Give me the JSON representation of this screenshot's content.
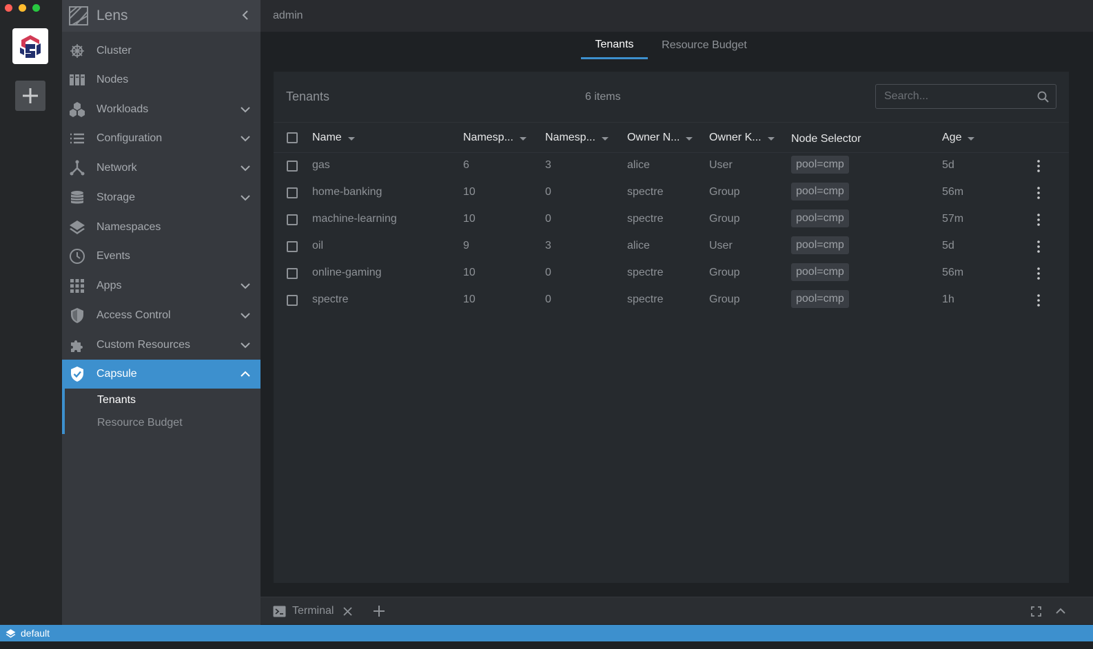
{
  "app": {
    "name": "Lens",
    "context": "admin"
  },
  "sidebar": {
    "items": [
      {
        "label": "Cluster",
        "icon": "helm-wheel-icon",
        "has_children": false
      },
      {
        "label": "Nodes",
        "icon": "nodes-icon",
        "has_children": false
      },
      {
        "label": "Workloads",
        "icon": "workloads-icon",
        "has_children": true
      },
      {
        "label": "Configuration",
        "icon": "list-icon",
        "has_children": true
      },
      {
        "label": "Network",
        "icon": "network-icon",
        "has_children": true
      },
      {
        "label": "Storage",
        "icon": "database-icon",
        "has_children": true
      },
      {
        "label": "Namespaces",
        "icon": "layers-icon",
        "has_children": false
      },
      {
        "label": "Events",
        "icon": "clock-icon",
        "has_children": false
      },
      {
        "label": "Apps",
        "icon": "apps-grid-icon",
        "has_children": true
      },
      {
        "label": "Access Control",
        "icon": "shield-icon",
        "has_children": true
      },
      {
        "label": "Custom Resources",
        "icon": "puzzle-icon",
        "has_children": true
      },
      {
        "label": "Capsule",
        "icon": "shield-check-icon",
        "has_children": true,
        "active": true
      }
    ],
    "sub_items": [
      {
        "label": "Tenants",
        "active": true
      },
      {
        "label": "Resource Budget",
        "active": false
      }
    ]
  },
  "tabs": [
    {
      "label": "Tenants",
      "active": true
    },
    {
      "label": "Resource Budget",
      "active": false
    }
  ],
  "panel": {
    "title": "Tenants",
    "count": "6 items",
    "search_placeholder": "Search..."
  },
  "table": {
    "columns": [
      "Name",
      "Namesp...",
      "Namesp...",
      "Owner N...",
      "Owner K...",
      "Node Selector",
      "Age"
    ],
    "rows": [
      {
        "name": "gas",
        "ns_quota": "6",
        "ns_count": "3",
        "owner_name": "alice",
        "owner_kind": "User",
        "node_selector": "pool=cmp",
        "age": "5d"
      },
      {
        "name": "home-banking",
        "ns_quota": "10",
        "ns_count": "0",
        "owner_name": "spectre",
        "owner_kind": "Group",
        "node_selector": "pool=cmp",
        "age": "56m"
      },
      {
        "name": "machine-learning",
        "ns_quota": "10",
        "ns_count": "0",
        "owner_name": "spectre",
        "owner_kind": "Group",
        "node_selector": "pool=cmp",
        "age": "57m"
      },
      {
        "name": "oil",
        "ns_quota": "9",
        "ns_count": "3",
        "owner_name": "alice",
        "owner_kind": "User",
        "node_selector": "pool=cmp",
        "age": "5d"
      },
      {
        "name": "online-gaming",
        "ns_quota": "10",
        "ns_count": "0",
        "owner_name": "spectre",
        "owner_kind": "Group",
        "node_selector": "pool=cmp",
        "age": "56m"
      },
      {
        "name": "spectre",
        "ns_quota": "10",
        "ns_count": "0",
        "owner_name": "spectre",
        "owner_kind": "Group",
        "node_selector": "pool=cmp",
        "age": "1h"
      }
    ]
  },
  "terminal": {
    "label": "Terminal"
  },
  "status_bar": {
    "namespace": "default"
  },
  "colors": {
    "accent": "#3d90ce",
    "sidebar_bg": "#36393e",
    "main_bg": "#1e2124",
    "panel_bg": "#262a2e"
  }
}
